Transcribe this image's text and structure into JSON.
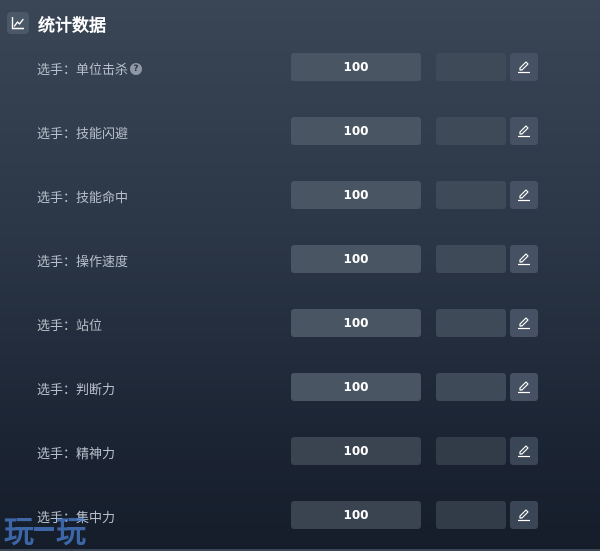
{
  "header": {
    "title": "统计数据",
    "icon": "line-chart-icon"
  },
  "rows": [
    {
      "label": "选手：单位击杀",
      "value": "100",
      "help": "?"
    },
    {
      "label": "选手：技能闪避",
      "value": "100"
    },
    {
      "label": "选手：技能命中",
      "value": "100"
    },
    {
      "label": "选手：操作速度",
      "value": "100"
    },
    {
      "label": "选手：站位",
      "value": "100"
    },
    {
      "label": "选手：判断力",
      "value": "100"
    },
    {
      "label": "选手：精神力",
      "value": "100"
    },
    {
      "label": "选手：集中力",
      "value": "100"
    }
  ],
  "watermark": {
    "char1": "玩",
    "char2": "玩"
  }
}
